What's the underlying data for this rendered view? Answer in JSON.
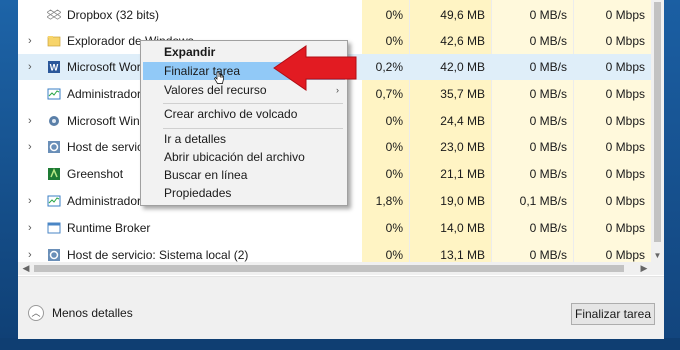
{
  "processes": [
    {
      "name": "Dropbox (32 bits)",
      "expand": false,
      "icon": "dropbox-icon",
      "cpu": "0%",
      "mem": "49,6 MB",
      "disk": "0 MB/s",
      "net": "0 Mbps"
    },
    {
      "name": "Explorador de Windows",
      "expand": true,
      "icon": "folder-icon",
      "cpu": "0%",
      "mem": "42,6 MB",
      "disk": "0 MB/s",
      "net": "0 Mbps"
    },
    {
      "name": "Microsoft Word",
      "expand": true,
      "icon": "word-icon",
      "cpu": "0,2%",
      "mem": "42,0 MB",
      "disk": "0 MB/s",
      "net": "0 Mbps"
    },
    {
      "name": "Administrador de tareas",
      "expand": false,
      "icon": "task-manager-icon",
      "cpu": "0,7%",
      "mem": "35,7 MB",
      "disk": "0 MB/s",
      "net": "0 Mbps"
    },
    {
      "name": "Microsoft Windows Search",
      "expand": true,
      "icon": "search-service-icon",
      "cpu": "0%",
      "mem": "24,4 MB",
      "disk": "0 MB/s",
      "net": "0 Mbps"
    },
    {
      "name": "Host de servicio",
      "expand": true,
      "icon": "gear-icon",
      "cpu": "0%",
      "mem": "23,0 MB",
      "disk": "0 MB/s",
      "net": "0 Mbps"
    },
    {
      "name": "Greenshot",
      "expand": false,
      "icon": "greenshot-icon",
      "cpu": "0%",
      "mem": "21,1 MB",
      "disk": "0 MB/s",
      "net": "0 Mbps"
    },
    {
      "name": "Administrador de tareas",
      "expand": true,
      "icon": "task-manager-icon",
      "cpu": "1,8%",
      "mem": "19,0 MB",
      "disk": "0,1 MB/s",
      "net": "0 Mbps"
    },
    {
      "name": "Runtime Broker",
      "expand": true,
      "icon": "window-icon",
      "cpu": "0%",
      "mem": "14,0 MB",
      "disk": "0 MB/s",
      "net": "0 Mbps"
    },
    {
      "name": "Host de servicio: Sistema local (2)",
      "expand": true,
      "icon": "gear-icon",
      "cpu": "0%",
      "mem": "13,1 MB",
      "disk": "0 MB/s",
      "net": "0 Mbps"
    }
  ],
  "context_menu": {
    "items": [
      {
        "label": "Expandir",
        "bold": true,
        "state": "normal"
      },
      {
        "label": "Finalizar tarea",
        "bold": false,
        "state": "hover"
      },
      {
        "label": "Valores del recurso",
        "bold": false,
        "state": "submenu"
      },
      {
        "label": "Crear archivo de volcado",
        "bold": false,
        "state": "normal"
      },
      {
        "label": "Ir a detalles",
        "bold": false,
        "state": "normal"
      },
      {
        "label": "Abrir ubicación del archivo",
        "bold": false,
        "state": "normal"
      },
      {
        "label": "Buscar en línea",
        "bold": false,
        "state": "normal"
      },
      {
        "label": "Propiedades",
        "bold": false,
        "state": "normal"
      }
    ]
  },
  "footer": {
    "fewer_details_label": "Menos detalles",
    "end_task_label": "Finalizar tarea"
  },
  "colors": {
    "cpu_mem_heat": "#fff4c4",
    "disk_net_heat": "#fff9dc",
    "highlight_row": "#dfeef9",
    "menu_hover": "#91c9f7",
    "annotation_arrow": "#e21b22"
  }
}
